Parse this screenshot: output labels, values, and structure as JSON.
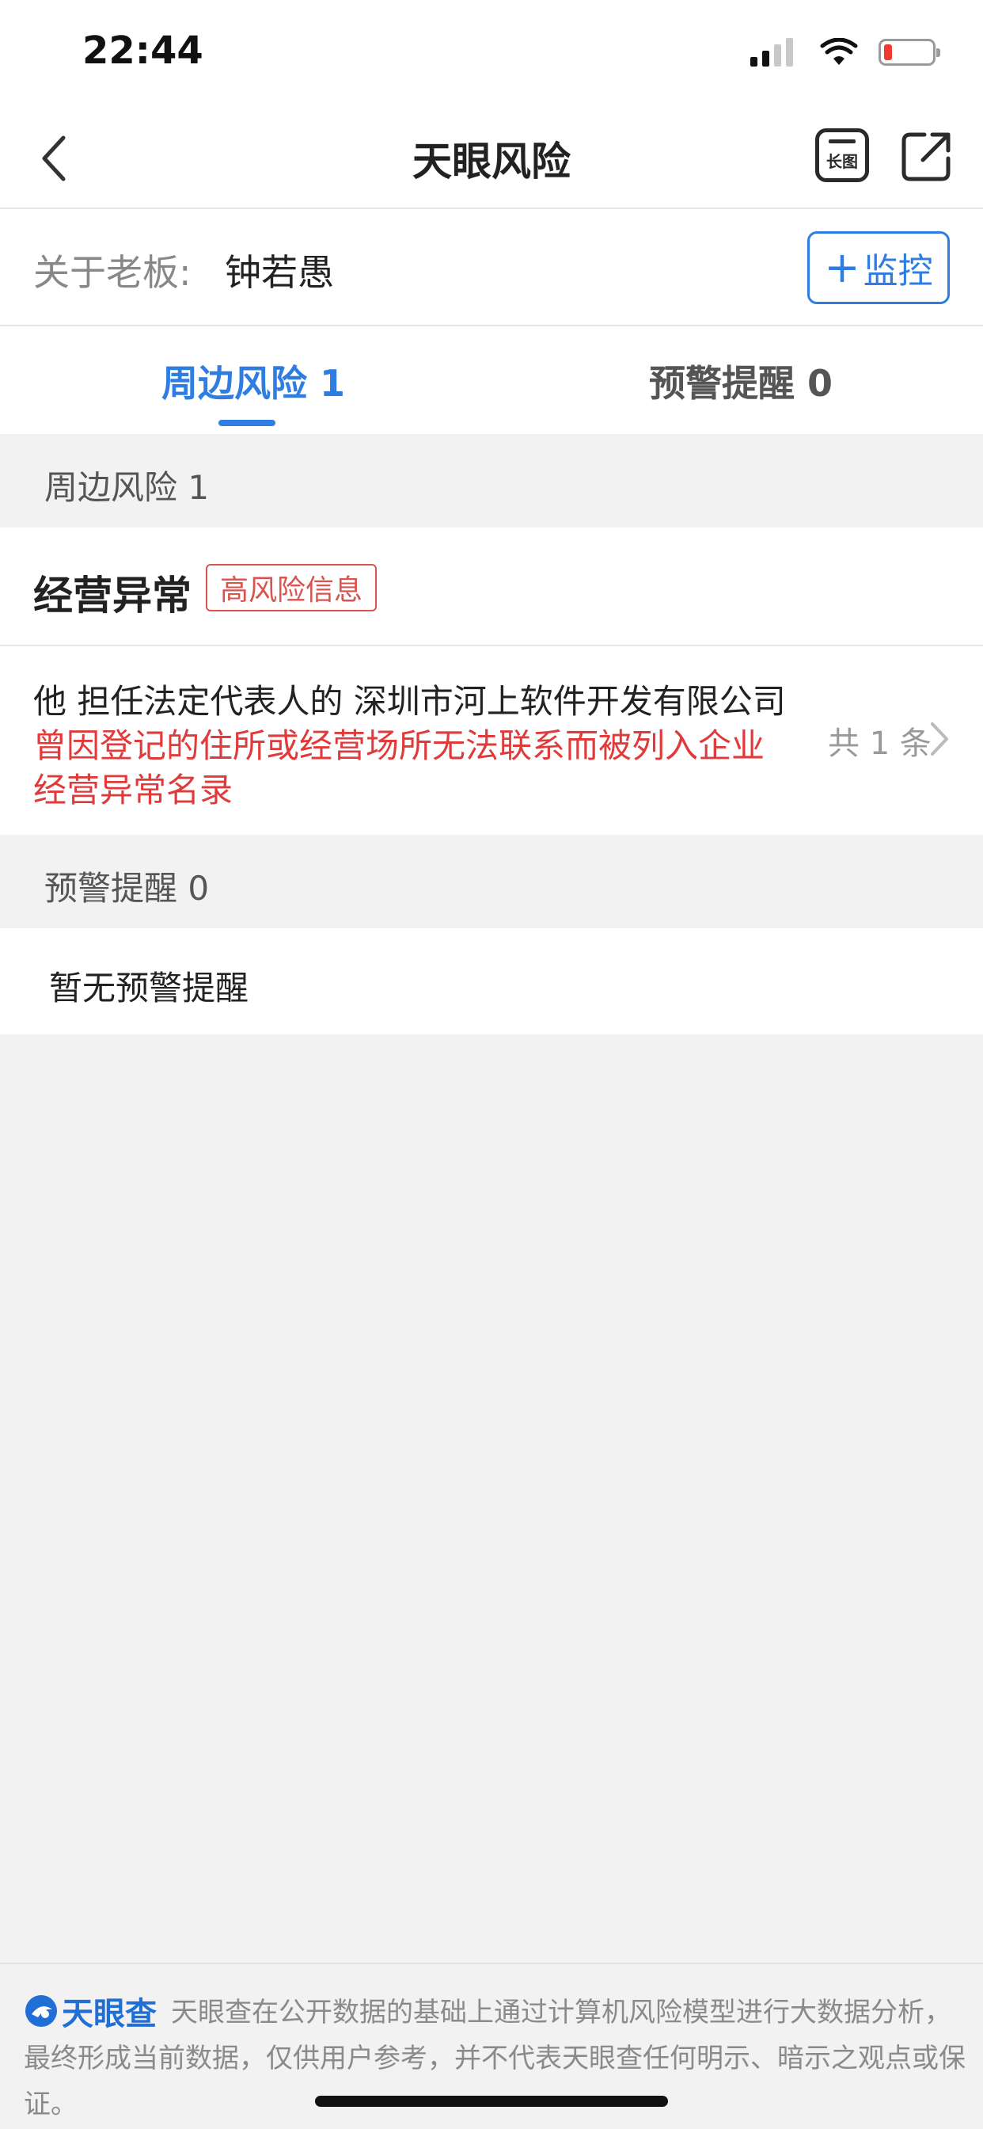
{
  "status_bar": {
    "time": "22:44"
  },
  "nav": {
    "title": "天眼风险",
    "long_image_label": "长图"
  },
  "boss": {
    "label": "关于老板:",
    "name": "钟若愚",
    "monitor_label": "监控"
  },
  "tabs": [
    {
      "label": "周边风险 1",
      "active": true
    },
    {
      "label": "预警提醒 0",
      "active": false
    }
  ],
  "section_surrounding": {
    "header": "周边风险 1",
    "category": "经营异常",
    "badge": "高风险信息",
    "item": {
      "text_plain": "他 担任法定代表人的 深圳市河上软件开发有限公司",
      "text_red": "曾因登记的住所或经营场所无法联系而被列入企业经营异常名录",
      "count": "共 1 条"
    }
  },
  "section_alert": {
    "header": "预警提醒 0",
    "empty_text": "暂无预警提醒"
  },
  "footer": {
    "brand": "天眼查",
    "disclaimer": "天眼查在公开数据的基础上通过计算机风险模型进行大数据分析，最终形成当前数据，仅供用户参考，并不代表天眼查任何明示、暗示之观点或保证。"
  },
  "colors": {
    "accent": "#2f7de1",
    "danger": "#e03a3a",
    "background": "#f2f2f2"
  }
}
